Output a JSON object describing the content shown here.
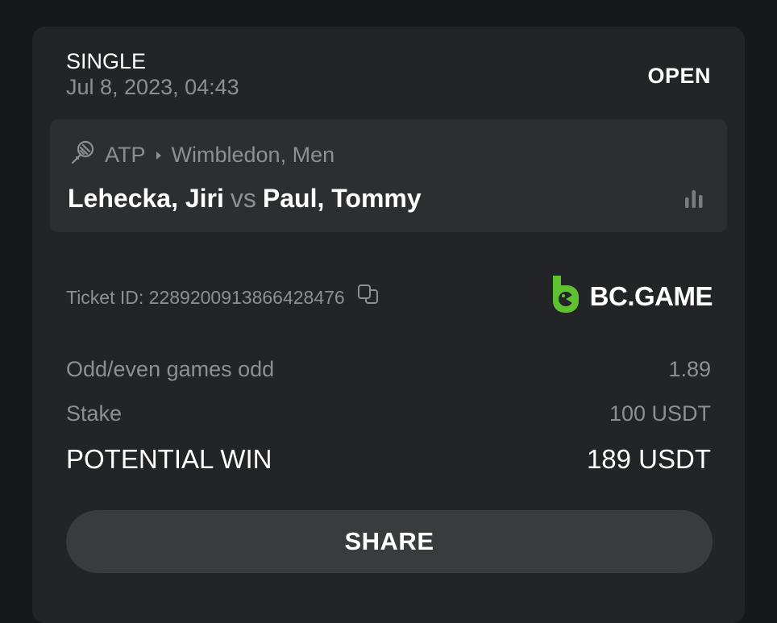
{
  "bet": {
    "type": "SINGLE",
    "date": "Jul 8, 2023, 04:43",
    "status": "OPEN"
  },
  "event": {
    "sport_icon": "tennis-racket-icon",
    "league": "ATP",
    "tournament": "Wimbledon, Men",
    "home": "Lehecka, Jiri",
    "vs": "vs",
    "away": "Paul, Tommy",
    "stats_icon": "bar-chart-icon"
  },
  "ticket": {
    "label": "Ticket ID: 2289200913866428476",
    "copy_icon": "copy-icon"
  },
  "brand": {
    "name": "BC.GAME",
    "logo_color": "#5ec130"
  },
  "selection": {
    "market": "Odd/even games odd",
    "odds": "1.89"
  },
  "stake": {
    "label": "Stake",
    "value": "100 USDT"
  },
  "potential_win": {
    "label": "POTENTIAL WIN",
    "value": "189 USDT"
  },
  "actions": {
    "share_label": "SHARE"
  },
  "colors": {
    "page_bg": "#17181b",
    "card_bg": "#232427",
    "event_bg": "#2d2e32",
    "button_bg": "#3a3b3f",
    "muted_text": "#8d8f94",
    "text": "#ffffff"
  }
}
